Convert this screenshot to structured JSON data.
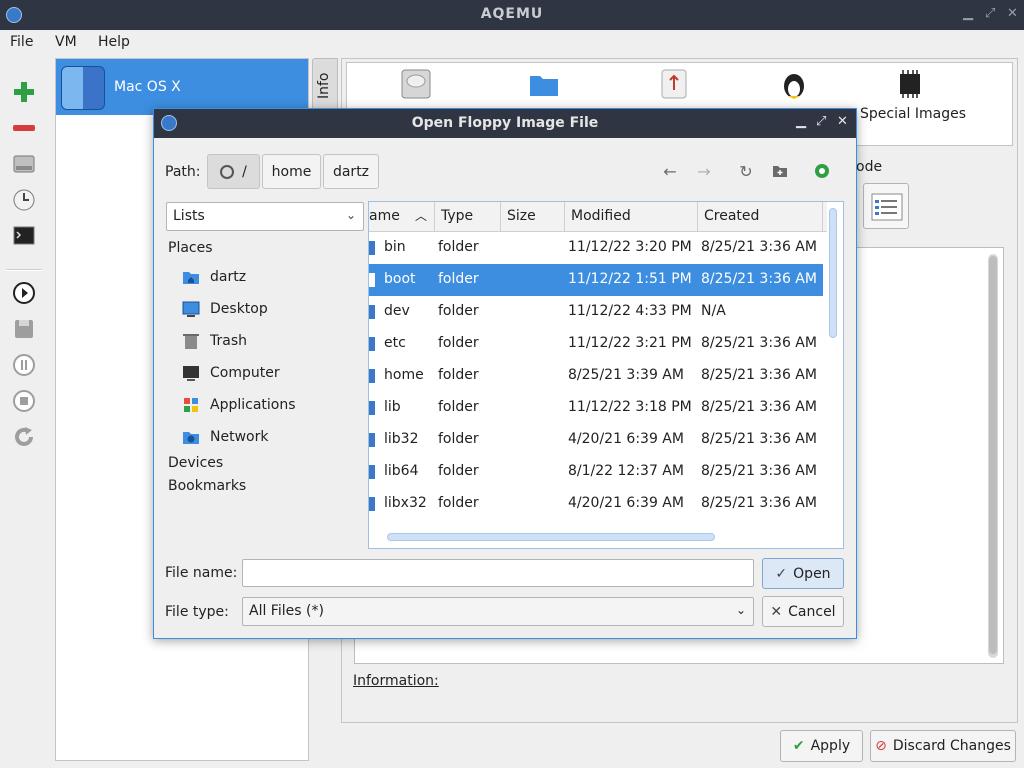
{
  "window": {
    "title": "AQEMU"
  },
  "menu": [
    "File",
    "VM",
    "Help"
  ],
  "vm_list": [
    {
      "name": "Mac OS X"
    }
  ],
  "side_tab": "Info",
  "right_panel": {
    "special_images_label": "Special Images",
    "mode_label": "ode",
    "information_label": "Information:"
  },
  "buttons": {
    "apply": "Apply",
    "discard": "Discard Changes"
  },
  "dialog": {
    "title": "Open Floppy Image File",
    "path_label": "Path:",
    "breadcrumbs": [
      "/",
      "home",
      "dartz"
    ],
    "sidebar_view": "Lists",
    "places_header": "Places",
    "places": [
      {
        "label": "dartz",
        "icon": "home-folder-icon"
      },
      {
        "label": "Desktop",
        "icon": "desktop-icon"
      },
      {
        "label": "Trash",
        "icon": "trash-icon"
      },
      {
        "label": "Computer",
        "icon": "computer-icon"
      },
      {
        "label": "Applications",
        "icon": "applications-icon"
      },
      {
        "label": "Network",
        "icon": "network-folder-icon"
      }
    ],
    "devices_header": "Devices",
    "bookmarks_header": "Bookmarks",
    "columns": [
      "ame",
      "Type",
      "Size",
      "Modified",
      "Created"
    ],
    "files": [
      {
        "name": "bin",
        "type": "folder",
        "size": "",
        "modified": "11/12/22 3:20 PM",
        "created": "8/25/21 3:36 AM"
      },
      {
        "name": "boot",
        "type": "folder",
        "size": "",
        "modified": "11/12/22 1:51 PM",
        "created": "8/25/21 3:36 AM"
      },
      {
        "name": "dev",
        "type": "folder",
        "size": "",
        "modified": "11/12/22 4:33 PM",
        "created": "N/A"
      },
      {
        "name": "etc",
        "type": "folder",
        "size": "",
        "modified": "11/12/22 3:21 PM",
        "created": "8/25/21 3:36 AM"
      },
      {
        "name": "home",
        "type": "folder",
        "size": "",
        "modified": "8/25/21 3:39 AM",
        "created": "8/25/21 3:36 AM"
      },
      {
        "name": "lib",
        "type": "folder",
        "size": "",
        "modified": "11/12/22 3:18 PM",
        "created": "8/25/21 3:36 AM"
      },
      {
        "name": "lib32",
        "type": "folder",
        "size": "",
        "modified": "4/20/21 6:39 AM",
        "created": "8/25/21 3:36 AM"
      },
      {
        "name": "lib64",
        "type": "folder",
        "size": "",
        "modified": "8/1/22 12:37 AM",
        "created": "8/25/21 3:36 AM"
      },
      {
        "name": "libx32",
        "type": "folder",
        "size": "",
        "modified": "4/20/21 6:39 AM",
        "created": "8/25/21 3:36 AM"
      }
    ],
    "selected_file": "boot",
    "file_name_label": "File name:",
    "file_name_value": "",
    "file_type_label": "File type:",
    "file_type_value": "All Files (*)",
    "open_label": "Open",
    "cancel_label": "Cancel"
  },
  "colors": {
    "accent": "#3d8ee0",
    "titlebar": "#2f3542"
  }
}
